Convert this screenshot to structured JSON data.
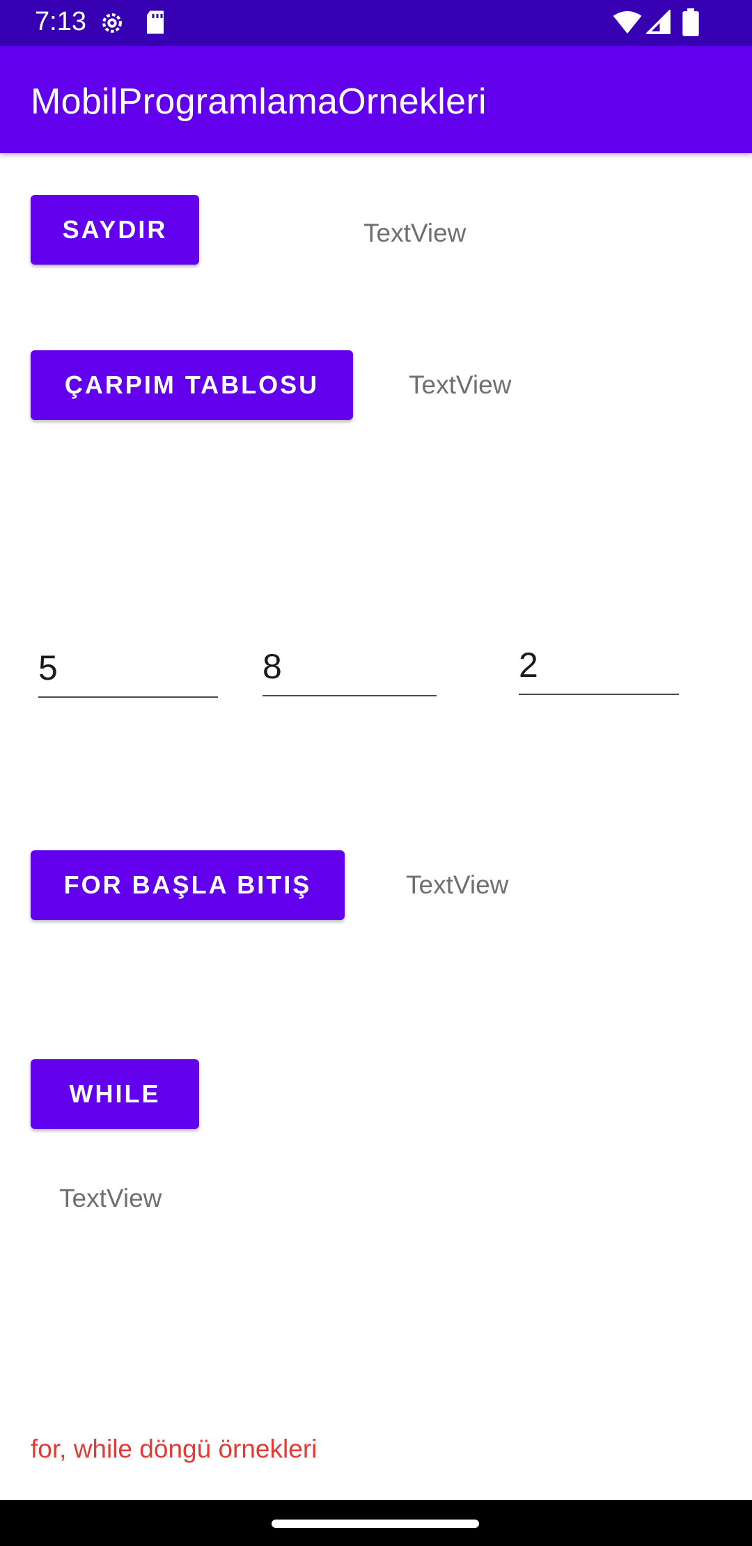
{
  "status_bar": {
    "time": "7:13",
    "icons": [
      "settings-gear-icon",
      "sd-card-icon",
      "wifi-icon",
      "signal-icon",
      "battery-icon"
    ]
  },
  "app_bar": {
    "title": "MobilProgramlamaOrnekleri"
  },
  "colors": {
    "primary": "#6200ee",
    "primary_dark": "#3700b3",
    "footer_text": "#e53935",
    "textview": "#6f6f6f"
  },
  "rows": {
    "saydir": {
      "button_label": "SAYDIR",
      "textview": "TextView"
    },
    "carpim": {
      "button_label": "ÇARPIM TABLOSU",
      "textview": "TextView"
    },
    "inputs": {
      "field1": "5",
      "field2": "8",
      "field3": "2"
    },
    "for_loop": {
      "button_label": "FOR BAŞLA BITIŞ",
      "textview": "TextView"
    },
    "while_loop": {
      "button_label": "WHILE",
      "textview": "TextView"
    }
  },
  "footer": {
    "text": "for, while döngü örnekleri"
  }
}
